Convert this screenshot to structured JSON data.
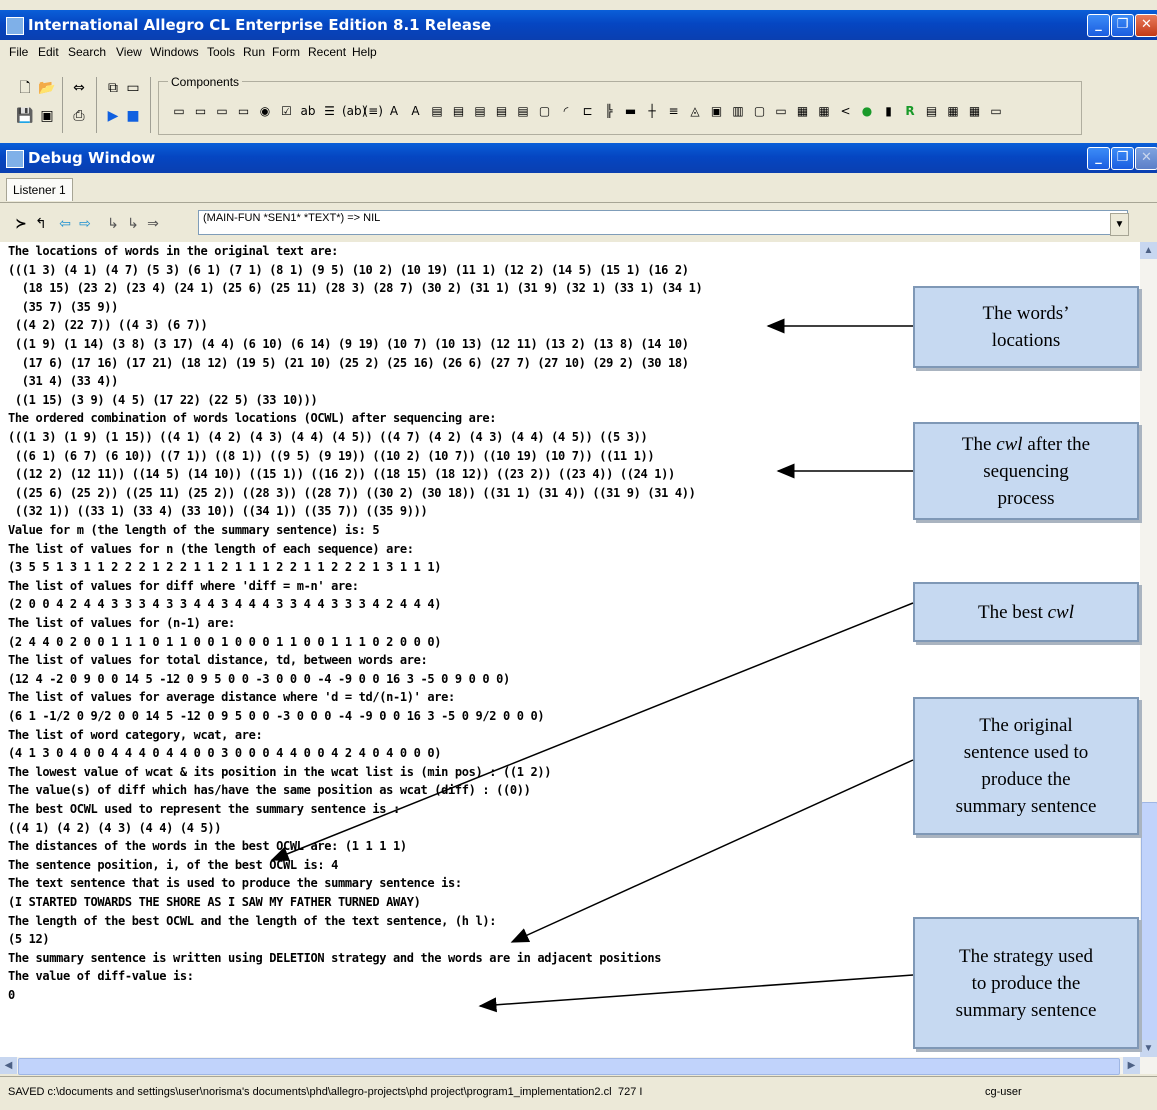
{
  "app": {
    "title": "International Allegro CL Enterprise Edition 8.1 Release"
  },
  "menu": [
    "File",
    "Edit",
    "Search",
    "View",
    "Windows",
    "Tools",
    "Run",
    "Form",
    "Recent",
    "Help"
  ],
  "toolbar": {
    "components_label": "Components"
  },
  "debug_window": {
    "title": "Debug Window",
    "tab": "Listener 1",
    "command": "(MAIN-FUN *SEN1* *TEXT*)   =>  NIL"
  },
  "lines": [
    "The locations of words in the original text are:",
    "(((1 3) (4 1) (4 7) (5 3) (6 1) (7 1) (8 1) (9 5) (10 2) (10 19) (11 1) (12 2) (14 5) (15 1) (16 2)",
    "  (18 15) (23 2) (23 4) (24 1) (25 6) (25 11) (28 3) (28 7) (30 2) (31 1) (31 9) (32 1) (33 1) (34 1)",
    "  (35 7) (35 9))",
    " ((4 2) (22 7)) ((4 3) (6 7))",
    " ((1 9) (1 14) (3 8) (3 17) (4 4) (6 10) (6 14) (9 19) (10 7) (10 13) (12 11) (13 2) (13 8) (14 10)",
    "  (17 6) (17 16) (17 21) (18 12) (19 5) (21 10) (25 2) (25 16) (26 6) (27 7) (27 10) (29 2) (30 18)",
    "  (31 4) (33 4))",
    " ((1 15) (3 9) (4 5) (17 22) (22 5) (33 10)))",
    "The ordered combination of words locations (OCWL) after sequencing are:",
    "(((1 3) (1 9) (1 15)) ((4 1) (4 2) (4 3) (4 4) (4 5)) ((4 7) (4 2) (4 3) (4 4) (4 5)) ((5 3))",
    " ((6 1) (6 7) (6 10)) ((7 1)) ((8 1)) ((9 5) (9 19)) ((10 2) (10 7)) ((10 19) (10 7)) ((11 1))",
    " ((12 2) (12 11)) ((14 5) (14 10)) ((15 1)) ((16 2)) ((18 15) (18 12)) ((23 2)) ((23 4)) ((24 1))",
    " ((25 6) (25 2)) ((25 11) (25 2)) ((28 3)) ((28 7)) ((30 2) (30 18)) ((31 1) (31 4)) ((31 9) (31 4))",
    " ((32 1)) ((33 1) (33 4) (33 10)) ((34 1)) ((35 7)) ((35 9)))",
    "Value for m (the length of the summary sentence) is: 5",
    "The list of values for n (the length of each sequence) are:",
    "(3 5 5 1 3 1 1 2 2 2 1 2 2 1 1 2 1 1 1 2 2 1 1 2 2 2 1 3 1 1 1)",
    "The list of values for diff where 'diff = m-n' are:",
    "(2 0 0 4 2 4 4 3 3 3 4 3 3 4 4 3 4 4 4 3 3 4 4 3 3 3 4 2 4 4 4)",
    "The list of values for (n-1) are:",
    "(2 4 4 0 2 0 0 1 1 1 0 1 1 0 0 1 0 0 0 1 1 0 0 1 1 1 0 2 0 0 0)",
    "The list of values for total distance, td, between words are:",
    "(12 4 -2 0 9 0 0 14 5 -12 0 9 5 0 0 -3 0 0 0 -4 -9 0 0 16 3 -5 0 9 0 0 0)",
    "The list of values for average distance where 'd = td/(n-1)' are:",
    "(6 1 -1/2 0 9/2 0 0 14 5 -12 0 9 5 0 0 -3 0 0 0 -4 -9 0 0 16 3 -5 0 9/2 0 0 0)",
    "The list of word category, wcat, are:",
    "(4 1 3 0 4 0 0 4 4 4 0 4 4 0 0 3 0 0 0 4 4 0 0 4 2 4 0 4 0 0 0)",
    "The lowest value of wcat & its position in the wcat list is (min pos) : ((1 2))",
    "The value(s) of diff which has/have the same position as wcat (diff) : ((0))",
    "The best OCWL used to represent the summary sentence is :",
    "((4 1) (4 2) (4 3) (4 4) (4 5))",
    "The distances of the words in the best OCWL are: (1 1 1 1)",
    "The sentence position, i, of the best OCWL is: 4",
    "The text sentence that is used to produce the summary sentence is:",
    "(I STARTED TOWARDS THE SHORE AS I SAW MY FATHER TURNED AWAY)",
    "The length of the best OCWL and the length of the text sentence, (h l):",
    "(5 12)",
    "The summary sentence is written using DELETION strategy and the words are in adjacent positions",
    "The value of diff-value is:",
    "0"
  ],
  "callouts": {
    "locations": [
      "The words’",
      "locations"
    ],
    "cwl_after": [
      "The cwl after the",
      "sequencing",
      "process"
    ],
    "best_cwl": [
      "The best cwl"
    ],
    "original": [
      "The original",
      "sentence used to",
      "produce the",
      "summary sentence"
    ],
    "strategy": [
      "The strategy used",
      "to produce the",
      "summary sentence"
    ]
  },
  "status": {
    "path": "SAVED c:\\documents and settings\\user\\norisma's documents\\phd\\allegro-projects\\phd project\\program1_implementation2.cl",
    "pos": "727 I",
    "package": "cg-user"
  }
}
